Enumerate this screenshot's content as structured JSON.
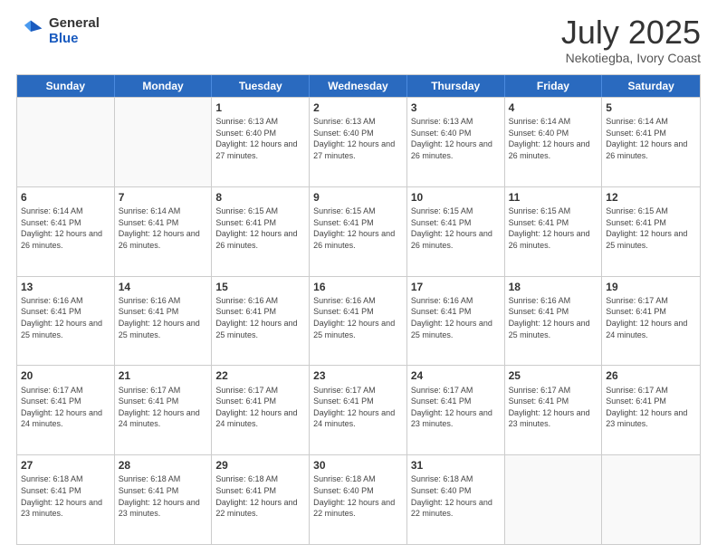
{
  "logo": {
    "general": "General",
    "blue": "Blue"
  },
  "title": {
    "month": "July 2025",
    "location": "Nekotiegba, Ivory Coast"
  },
  "header": {
    "days": [
      "Sunday",
      "Monday",
      "Tuesday",
      "Wednesday",
      "Thursday",
      "Friday",
      "Saturday"
    ]
  },
  "weeks": [
    [
      {
        "day": "",
        "sunrise": "",
        "sunset": "",
        "daylight": ""
      },
      {
        "day": "",
        "sunrise": "",
        "sunset": "",
        "daylight": ""
      },
      {
        "day": "1",
        "sunrise": "Sunrise: 6:13 AM",
        "sunset": "Sunset: 6:40 PM",
        "daylight": "Daylight: 12 hours and 27 minutes."
      },
      {
        "day": "2",
        "sunrise": "Sunrise: 6:13 AM",
        "sunset": "Sunset: 6:40 PM",
        "daylight": "Daylight: 12 hours and 27 minutes."
      },
      {
        "day": "3",
        "sunrise": "Sunrise: 6:13 AM",
        "sunset": "Sunset: 6:40 PM",
        "daylight": "Daylight: 12 hours and 26 minutes."
      },
      {
        "day": "4",
        "sunrise": "Sunrise: 6:14 AM",
        "sunset": "Sunset: 6:40 PM",
        "daylight": "Daylight: 12 hours and 26 minutes."
      },
      {
        "day": "5",
        "sunrise": "Sunrise: 6:14 AM",
        "sunset": "Sunset: 6:41 PM",
        "daylight": "Daylight: 12 hours and 26 minutes."
      }
    ],
    [
      {
        "day": "6",
        "sunrise": "Sunrise: 6:14 AM",
        "sunset": "Sunset: 6:41 PM",
        "daylight": "Daylight: 12 hours and 26 minutes."
      },
      {
        "day": "7",
        "sunrise": "Sunrise: 6:14 AM",
        "sunset": "Sunset: 6:41 PM",
        "daylight": "Daylight: 12 hours and 26 minutes."
      },
      {
        "day": "8",
        "sunrise": "Sunrise: 6:15 AM",
        "sunset": "Sunset: 6:41 PM",
        "daylight": "Daylight: 12 hours and 26 minutes."
      },
      {
        "day": "9",
        "sunrise": "Sunrise: 6:15 AM",
        "sunset": "Sunset: 6:41 PM",
        "daylight": "Daylight: 12 hours and 26 minutes."
      },
      {
        "day": "10",
        "sunrise": "Sunrise: 6:15 AM",
        "sunset": "Sunset: 6:41 PM",
        "daylight": "Daylight: 12 hours and 26 minutes."
      },
      {
        "day": "11",
        "sunrise": "Sunrise: 6:15 AM",
        "sunset": "Sunset: 6:41 PM",
        "daylight": "Daylight: 12 hours and 26 minutes."
      },
      {
        "day": "12",
        "sunrise": "Sunrise: 6:15 AM",
        "sunset": "Sunset: 6:41 PM",
        "daylight": "Daylight: 12 hours and 25 minutes."
      }
    ],
    [
      {
        "day": "13",
        "sunrise": "Sunrise: 6:16 AM",
        "sunset": "Sunset: 6:41 PM",
        "daylight": "Daylight: 12 hours and 25 minutes."
      },
      {
        "day": "14",
        "sunrise": "Sunrise: 6:16 AM",
        "sunset": "Sunset: 6:41 PM",
        "daylight": "Daylight: 12 hours and 25 minutes."
      },
      {
        "day": "15",
        "sunrise": "Sunrise: 6:16 AM",
        "sunset": "Sunset: 6:41 PM",
        "daylight": "Daylight: 12 hours and 25 minutes."
      },
      {
        "day": "16",
        "sunrise": "Sunrise: 6:16 AM",
        "sunset": "Sunset: 6:41 PM",
        "daylight": "Daylight: 12 hours and 25 minutes."
      },
      {
        "day": "17",
        "sunrise": "Sunrise: 6:16 AM",
        "sunset": "Sunset: 6:41 PM",
        "daylight": "Daylight: 12 hours and 25 minutes."
      },
      {
        "day": "18",
        "sunrise": "Sunrise: 6:16 AM",
        "sunset": "Sunset: 6:41 PM",
        "daylight": "Daylight: 12 hours and 25 minutes."
      },
      {
        "day": "19",
        "sunrise": "Sunrise: 6:17 AM",
        "sunset": "Sunset: 6:41 PM",
        "daylight": "Daylight: 12 hours and 24 minutes."
      }
    ],
    [
      {
        "day": "20",
        "sunrise": "Sunrise: 6:17 AM",
        "sunset": "Sunset: 6:41 PM",
        "daylight": "Daylight: 12 hours and 24 minutes."
      },
      {
        "day": "21",
        "sunrise": "Sunrise: 6:17 AM",
        "sunset": "Sunset: 6:41 PM",
        "daylight": "Daylight: 12 hours and 24 minutes."
      },
      {
        "day": "22",
        "sunrise": "Sunrise: 6:17 AM",
        "sunset": "Sunset: 6:41 PM",
        "daylight": "Daylight: 12 hours and 24 minutes."
      },
      {
        "day": "23",
        "sunrise": "Sunrise: 6:17 AM",
        "sunset": "Sunset: 6:41 PM",
        "daylight": "Daylight: 12 hours and 24 minutes."
      },
      {
        "day": "24",
        "sunrise": "Sunrise: 6:17 AM",
        "sunset": "Sunset: 6:41 PM",
        "daylight": "Daylight: 12 hours and 23 minutes."
      },
      {
        "day": "25",
        "sunrise": "Sunrise: 6:17 AM",
        "sunset": "Sunset: 6:41 PM",
        "daylight": "Daylight: 12 hours and 23 minutes."
      },
      {
        "day": "26",
        "sunrise": "Sunrise: 6:17 AM",
        "sunset": "Sunset: 6:41 PM",
        "daylight": "Daylight: 12 hours and 23 minutes."
      }
    ],
    [
      {
        "day": "27",
        "sunrise": "Sunrise: 6:18 AM",
        "sunset": "Sunset: 6:41 PM",
        "daylight": "Daylight: 12 hours and 23 minutes."
      },
      {
        "day": "28",
        "sunrise": "Sunrise: 6:18 AM",
        "sunset": "Sunset: 6:41 PM",
        "daylight": "Daylight: 12 hours and 23 minutes."
      },
      {
        "day": "29",
        "sunrise": "Sunrise: 6:18 AM",
        "sunset": "Sunset: 6:41 PM",
        "daylight": "Daylight: 12 hours and 22 minutes."
      },
      {
        "day": "30",
        "sunrise": "Sunrise: 6:18 AM",
        "sunset": "Sunset: 6:40 PM",
        "daylight": "Daylight: 12 hours and 22 minutes."
      },
      {
        "day": "31",
        "sunrise": "Sunrise: 6:18 AM",
        "sunset": "Sunset: 6:40 PM",
        "daylight": "Daylight: 12 hours and 22 minutes."
      },
      {
        "day": "",
        "sunrise": "",
        "sunset": "",
        "daylight": ""
      },
      {
        "day": "",
        "sunrise": "",
        "sunset": "",
        "daylight": ""
      }
    ]
  ]
}
